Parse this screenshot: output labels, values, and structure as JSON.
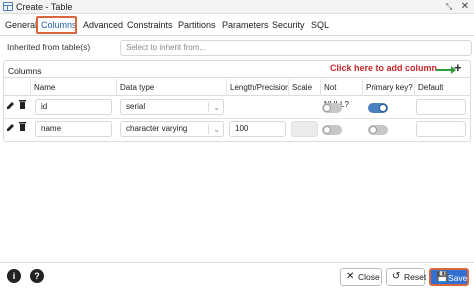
{
  "window": {
    "title": "Create - Table"
  },
  "tabs": [
    {
      "label": "General"
    },
    {
      "label": "Columns"
    },
    {
      "label": "Advanced"
    },
    {
      "label": "Constraints"
    },
    {
      "label": "Partitions"
    },
    {
      "label": "Parameters"
    },
    {
      "label": "Security"
    },
    {
      "label": "SQL"
    }
  ],
  "inherit": {
    "label": "Inherited from table(s)",
    "placeholder": "Select to inherit from..."
  },
  "columns_panel": {
    "title": "Columns",
    "annotation": "Click here to add column",
    "add_symbol": "+",
    "headers": [
      "Name",
      "Data type",
      "Length/Precision",
      "Scale",
      "Not NULL?",
      "Primary key?",
      "Default"
    ],
    "rows": [
      {
        "name": "id",
        "data_type": "serial",
        "length": "",
        "scale": "",
        "not_null": false,
        "primary_key": true,
        "default": ""
      },
      {
        "name": "name",
        "data_type": "character varying",
        "length": "100",
        "scale": "",
        "not_null": false,
        "primary_key": false,
        "default": ""
      }
    ]
  },
  "footer": {
    "info_symbol": "i",
    "help_symbol": "?",
    "close_label": "Close",
    "reset_label": "Reset",
    "save_label": "Save"
  },
  "colors": {
    "accent": "#326fd1",
    "highlight": "#d9673d",
    "annotation": "#c62828",
    "arrow": "#2e9d3a"
  }
}
